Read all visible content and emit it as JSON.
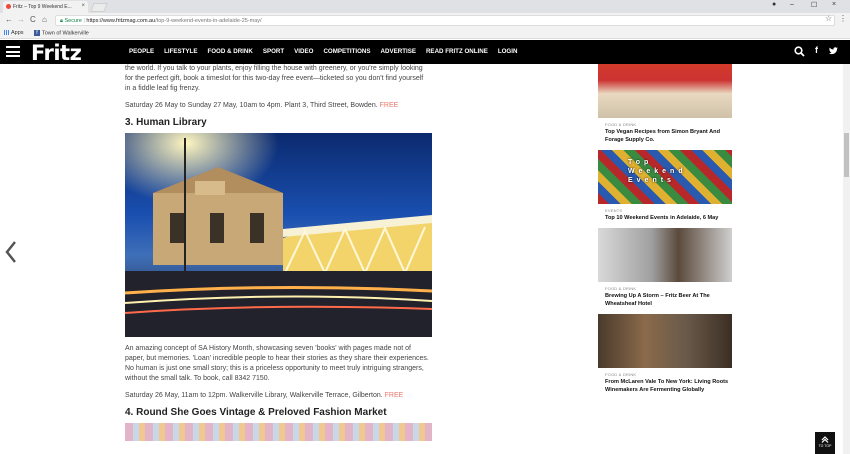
{
  "browser": {
    "tab_title": "Fritz – Top 9 Weekend E...",
    "tab_close": "×",
    "win_user": "●",
    "win_min": "–",
    "win_max": "☐",
    "win_close": "×",
    "back": "←",
    "forward": "→",
    "reload": "C",
    "home": "⌂",
    "secure_label": "Secure",
    "url_domain": "https://www.fritzmag.com.au",
    "url_path": "/top-9-weekend-events-in-adelaide-25-may/",
    "star": "☆",
    "menu": "⋮",
    "bookmarks": [
      {
        "label": "Apps"
      },
      {
        "label": "Town of Walkerville"
      }
    ]
  },
  "site": {
    "logo": "Fritz",
    "nav": [
      "PEOPLE",
      "LIFESTYLE",
      "FOOD & DRINK",
      "SPORT",
      "VIDEO",
      "COMPETITIONS",
      "ADVERTISE",
      "READ FRITZ ONLINE",
      "LOGIN"
    ],
    "facebook": "f"
  },
  "article": {
    "intro_line1": "the world. If you talk to your plants, enjoy filling the house with greenery, or you're simply looking",
    "intro_line2": "for the perfect gift, book a timeslot for this two-day free event—ticketed so you don't find yourself",
    "intro_line3": "in a fiddle leaf fig frenzy.",
    "event2_details": "Saturday 26 May to Sunday 27 May, 10am to 4pm. Plant 3, Third Street, Bowden.",
    "event2_free": "FREE",
    "event3_heading": "3. Human Library",
    "event3_desc": "An amazing concept of SA History Month, showcasing seven 'books' with pages made not of paper, but memories. 'Loan' incredible people to hear their stories as they share their experiences. No human is just one small story; this is a priceless opportunity to meet truly intriguing strangers, without the small talk. To book, call 8342 7150.",
    "event3_details": "Saturday 26 May, 11am to 12pm. Walkerville Library, Walkerville Terrace, Gilberton.",
    "event3_free": "FREE",
    "event4_heading": "4. Round She Goes Vintage & Preloved Fashion Market"
  },
  "sidebar": {
    "cards": [
      {
        "category": "FOOD & DRINK",
        "title": "Top Vegan Recipes from Simon Bryant And Forage Supply Co."
      },
      {
        "category": "EVENTS",
        "title": "Top 10 Weekend Events in Adelaide, 6 May",
        "overlay": "Top Weekend Events"
      },
      {
        "category": "FOOD & DRINK",
        "title": "Brewing Up A Storm – Fritz Beer At The Wheatsheaf Hotel"
      },
      {
        "category": "FOOD & DRINK",
        "title": "From McLaren Vale To New York: Living Roots Winemakers Are Fermenting Globally"
      }
    ]
  },
  "to_top_label": "TO TOP"
}
